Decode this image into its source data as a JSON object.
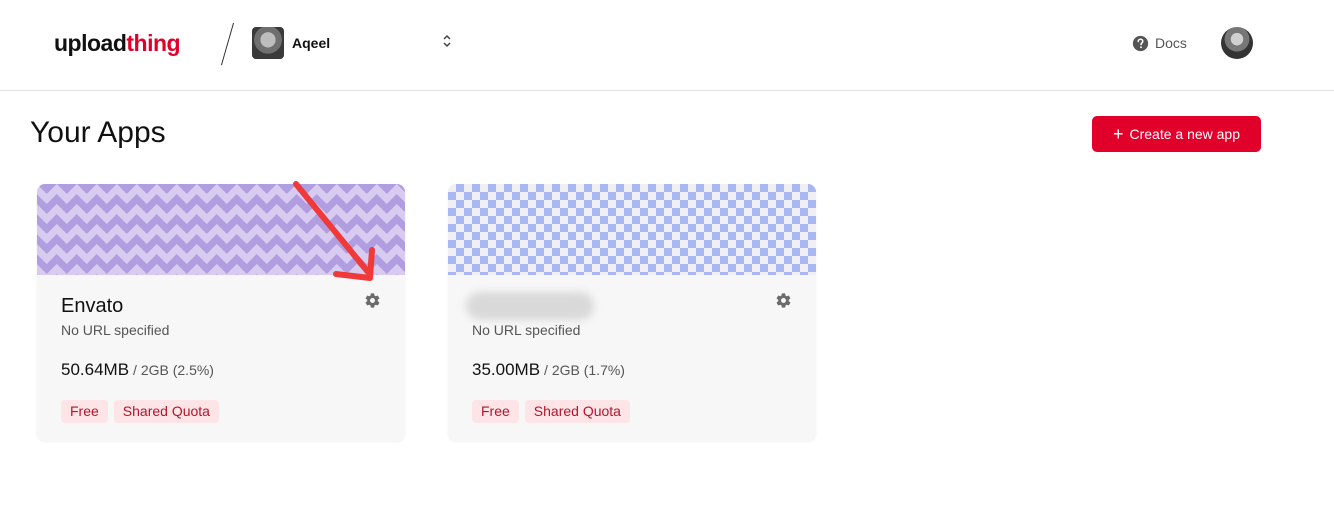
{
  "header": {
    "logo": {
      "part1": "upload",
      "part2": "thing"
    },
    "team": {
      "name": "Aqeel",
      "chevron": "⌃⌄"
    },
    "docs_label": "Docs",
    "icons": {
      "docs": "question-circle-icon",
      "team_switch": "chevron-up-down-icon",
      "user": "user-avatar"
    }
  },
  "main": {
    "title": "Your Apps",
    "create_button_label": "Create a new app"
  },
  "apps": [
    {
      "name": "Envato",
      "url_text": "No URL specified",
      "usage": "50.64MB",
      "quota": "/ 2GB (2.5%)",
      "badges": [
        "Free",
        "Shared Quota"
      ],
      "banner": "zigzag",
      "settings_icon": "gear-icon"
    },
    {
      "name": "",
      "name_blurred": true,
      "url_text": "No URL specified",
      "usage": "35.00MB",
      "quota": "/ 2GB (1.7%)",
      "badges": [
        "Free",
        "Shared Quota"
      ],
      "banner": "checker",
      "settings_icon": "gear-icon"
    }
  ],
  "colors": {
    "brand": "#e1002a",
    "badge_bg": "#fde4e6",
    "badge_text": "#b3162b",
    "annotation_arrow": "#f03a3a"
  }
}
